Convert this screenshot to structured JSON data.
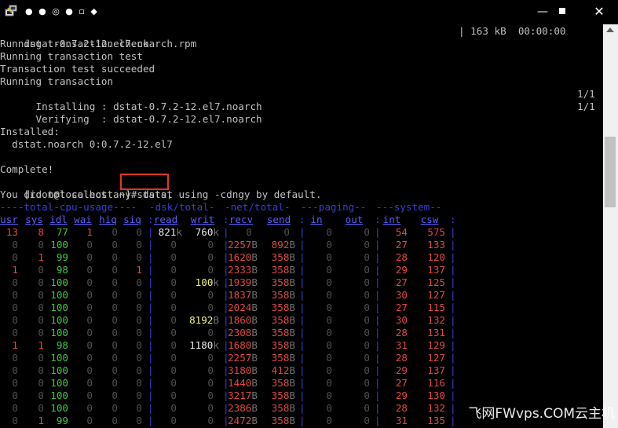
{
  "window": {
    "title": "● ● ◎ ● ▫ ◆",
    "icons": {
      "app": "putty-icon",
      "minimize": "minimize-icon",
      "maximize": "maximize-icon",
      "close": "close-icon"
    },
    "minimize_glyph": "—",
    "close_glyph": "✕"
  },
  "terminal": {
    "download_line": "dstat-0.7.2-12.el7.noarch.rpm",
    "download_stats": "| 163 kB  00:00:00",
    "lines": [
      "Running transaction check",
      "Running transaction test",
      "Transaction test succeeded",
      "Running transaction",
      "  Installing : dstat-0.7.2-12.el7.noarch",
      "  Verifying  : dstat-0.7.2-12.el7.noarch",
      "",
      "Installed:",
      "  dstat.noarch 0:0.7.2-12.el7",
      "",
      "Complete!"
    ],
    "progress_installing": "1/1",
    "progress_verifying": "1/1",
    "prompt": "[root@localhost ~]# ",
    "command": "dstat",
    "notice": "You did not select any stats, using -cdngy by default."
  },
  "dstat": {
    "groups": [
      "----total-cpu-usage----",
      "-dsk/total-",
      "-net/total-",
      "---paging--",
      "---system--"
    ],
    "columns": [
      "usr",
      "sys",
      "idl",
      "wai",
      "hiq",
      "siq",
      "read",
      "writ",
      "recv",
      "send",
      "in",
      "out",
      "int",
      "csw"
    ],
    "rows": [
      [
        "13",
        "8",
        "77",
        "1",
        "0",
        "0",
        "821k",
        "760k",
        "0",
        "0",
        "0",
        "0",
        "54",
        "575"
      ],
      [
        "0",
        "0",
        "100",
        "0",
        "0",
        "0",
        "0",
        "0",
        "2257B",
        "892B",
        "0",
        "0",
        "27",
        "133"
      ],
      [
        "0",
        "1",
        "99",
        "0",
        "0",
        "0",
        "0",
        "0",
        "1620B",
        "358B",
        "0",
        "0",
        "28",
        "120"
      ],
      [
        "1",
        "0",
        "98",
        "0",
        "0",
        "1",
        "0",
        "0",
        "2333B",
        "358B",
        "0",
        "0",
        "29",
        "137"
      ],
      [
        "0",
        "0",
        "100",
        "0",
        "0",
        "0",
        "0",
        "100k",
        "1939B",
        "358B",
        "0",
        "0",
        "27",
        "125"
      ],
      [
        "0",
        "0",
        "100",
        "0",
        "0",
        "0",
        "0",
        "0",
        "1837B",
        "358B",
        "0",
        "0",
        "30",
        "127"
      ],
      [
        "0",
        "0",
        "100",
        "0",
        "0",
        "0",
        "0",
        "0",
        "2024B",
        "358B",
        "0",
        "0",
        "27",
        "115"
      ],
      [
        "0",
        "0",
        "100",
        "0",
        "0",
        "0",
        "0",
        "8192B",
        "1860B",
        "358B",
        "0",
        "0",
        "30",
        "132"
      ],
      [
        "0",
        "0",
        "100",
        "0",
        "0",
        "0",
        "0",
        "0",
        "2308B",
        "358B",
        "0",
        "0",
        "28",
        "131"
      ],
      [
        "1",
        "1",
        "98",
        "0",
        "0",
        "0",
        "0",
        "1180k",
        "1680B",
        "358B",
        "0",
        "0",
        "31",
        "129"
      ],
      [
        "0",
        "0",
        "100",
        "0",
        "0",
        "0",
        "0",
        "0",
        "2257B",
        "358B",
        "0",
        "0",
        "28",
        "127"
      ],
      [
        "0",
        "0",
        "100",
        "0",
        "0",
        "0",
        "0",
        "0",
        "3180B",
        "412B",
        "0",
        "0",
        "29",
        "137"
      ],
      [
        "0",
        "0",
        "100",
        "0",
        "0",
        "0",
        "0",
        "0",
        "1440B",
        "358B",
        "0",
        "0",
        "27",
        "116"
      ],
      [
        "0",
        "0",
        "100",
        "0",
        "0",
        "0",
        "0",
        "0",
        "3217B",
        "358B",
        "0",
        "0",
        "29",
        "130"
      ],
      [
        "0",
        "0",
        "100",
        "0",
        "0",
        "0",
        "0",
        "0",
        "2386B",
        "358B",
        "0",
        "0",
        "28",
        "132"
      ],
      [
        "0",
        "1",
        "99",
        "0",
        "0",
        "0",
        "0",
        "0",
        "2472B",
        "358B",
        "0",
        "0",
        "31",
        "135"
      ]
    ]
  },
  "watermark": "飞网FWvps.COM云主机",
  "colors": {
    "highlight_box": "#e0352b",
    "header_blue": "#5c5cff",
    "value_red": "#e04848",
    "value_green": "#3ec83e"
  }
}
